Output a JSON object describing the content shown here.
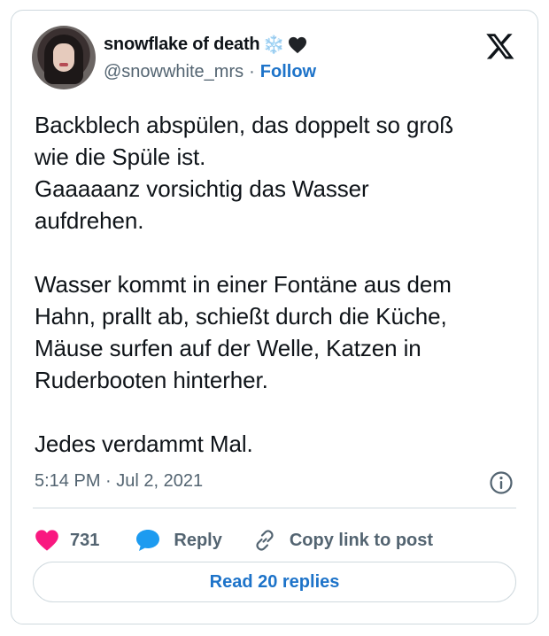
{
  "tweet": {
    "author": {
      "display_name": "snowflake of death",
      "display_name_emoji_1": "❄️",
      "display_name_emoji_2_icon": "black-heart-icon",
      "handle": "@snowwhite_mrs",
      "separator": "·",
      "follow_label": "Follow",
      "avatar_icon": "profile-photo"
    },
    "platform_icon": "x-logo-icon",
    "text": "Backblech abspülen, das doppelt so groß\nwie die Spüle ist.\nGaaaaanz vorsichtig das Wasser\naufdrehen.\n\nWasser kommt in einer Fontäne aus dem\nHahn, prallt ab, schießt durch die Küche,\nMäuse surfen auf der Welle, Katzen in\nRuderbooten hinterher.\n\nJedes verdammt Mal.",
    "timestamp": "5:14 PM · Jul 2, 2021",
    "actions": {
      "like_count": "731",
      "reply_label": "Reply",
      "copy_link_label": "Copy link to post"
    },
    "read_replies_label": "Read 20 replies",
    "colors": {
      "like": "#f91880",
      "reply": "#1d9bf0",
      "link": "#1d73c9",
      "secondary_text": "#536471",
      "border": "#cfd9de"
    }
  }
}
